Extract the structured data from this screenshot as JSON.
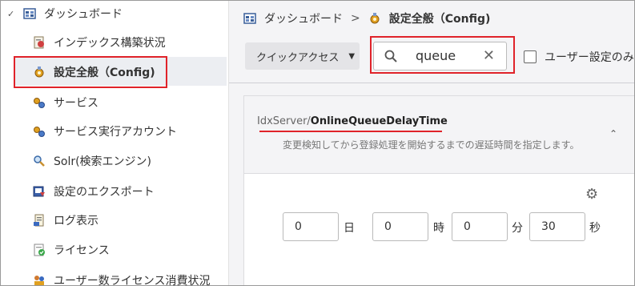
{
  "sidebar": {
    "root": {
      "label": "ダッシュボード",
      "expanded": true
    },
    "items": [
      {
        "label": "インデックス構築状況",
        "icon": "index-build-icon"
      },
      {
        "label": "設定全般（Config)",
        "icon": "config-icon",
        "selected": true
      },
      {
        "label": "サービス",
        "icon": "service-icon"
      },
      {
        "label": "サービス実行アカウント",
        "icon": "service-account-icon"
      },
      {
        "label": "Solr(検索エンジン)",
        "icon": "magnifier-icon"
      },
      {
        "label": "設定のエクスポート",
        "icon": "export-icon"
      },
      {
        "label": "ログ表示",
        "icon": "log-icon"
      },
      {
        "label": "ライセンス",
        "icon": "license-icon"
      },
      {
        "label": "ユーザー数ライセンス消費状況",
        "icon": "user-license-icon"
      }
    ]
  },
  "breadcrumb": {
    "root": "ダッシュボード",
    "separator": ">",
    "current": "設定全般（Config)"
  },
  "toolbar": {
    "quick_access_label": "クイックアクセス",
    "search_value": "queue",
    "checkbox_label": "ユーザー設定のみ",
    "checkbox_checked": false
  },
  "setting": {
    "path_prefix": "IdxServer/",
    "key": "OnlineQueueDelayTime",
    "description": "変更検知してから登録処理を開始するまでの遅延時間を指定します。",
    "fields": [
      {
        "value": "0",
        "unit": "日"
      },
      {
        "value": "0",
        "unit": "時"
      },
      {
        "value": "0",
        "unit": "分"
      },
      {
        "value": "30",
        "unit": "秒"
      }
    ]
  },
  "colors": {
    "highlight_red": "#e0232a",
    "selected_bg": "#eceef2"
  }
}
